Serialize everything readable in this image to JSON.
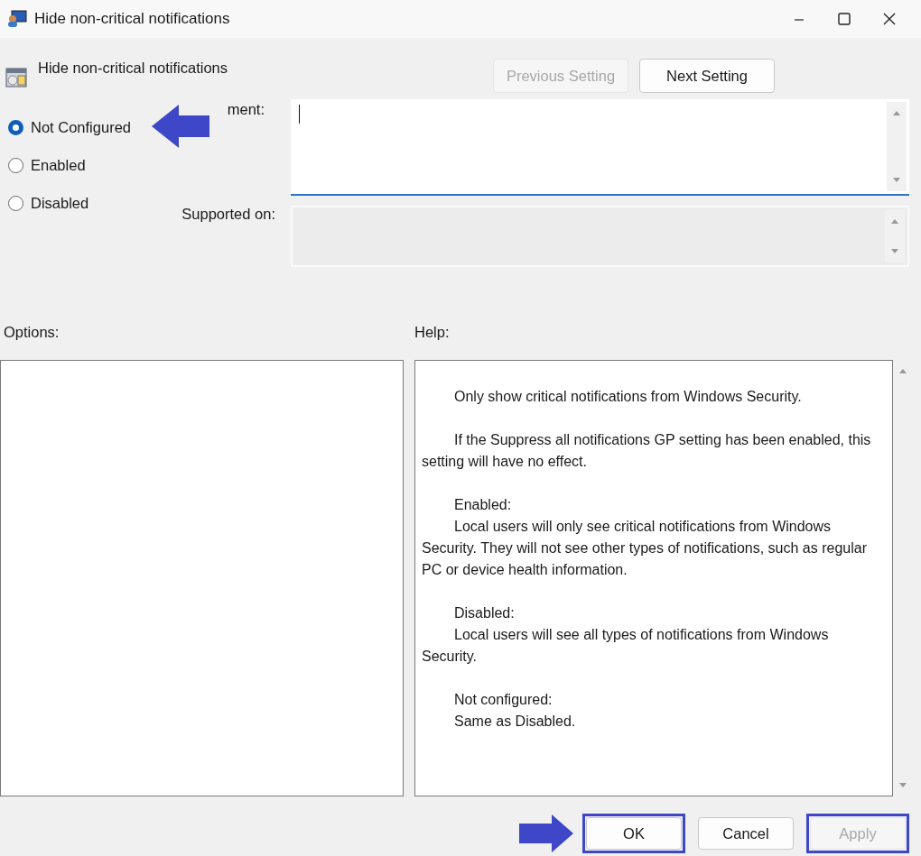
{
  "window": {
    "title": "Hide non-critical notifications"
  },
  "header": {
    "title": "Hide non-critical notifications"
  },
  "nav_buttons": [
    {
      "label": "Previous Setting",
      "disabled": true
    },
    {
      "label": "Next Setting",
      "disabled": false
    }
  ],
  "radios": [
    {
      "label": "Not Configured",
      "selected": true,
      "pointed": true
    },
    {
      "label": "Enabled",
      "selected": false,
      "pointed": false
    },
    {
      "label": "Disabled",
      "selected": false,
      "pointed": false
    }
  ],
  "comment": {
    "label": "ment:"
  },
  "supported_on": {
    "label": "Supported on:"
  },
  "options": {
    "label": "Options:"
  },
  "help": {
    "label": "Help:",
    "paragraphs": [
      [
        "Only show critical notifications from Windows Security."
      ],
      [
        "If the Suppress all notifications GP setting has been enabled, this setting will have no effect."
      ],
      [
        "Enabled:",
        "Local users will only see critical notifications from Windows Security. They will not see other types of notifications, such as regular PC or device health information."
      ],
      [
        "Disabled:",
        "Local users will see all types of notifications from Windows Security."
      ],
      [
        "Not configured:",
        "Same as Disabled."
      ]
    ]
  },
  "buttons": [
    {
      "label": "OK",
      "disabled": false,
      "highlighted": true,
      "pointed": true
    },
    {
      "label": "Cancel",
      "disabled": false,
      "highlighted": false,
      "pointed": false
    },
    {
      "label": "Apply",
      "disabled": true,
      "highlighted": true,
      "pointed": false
    }
  ]
}
